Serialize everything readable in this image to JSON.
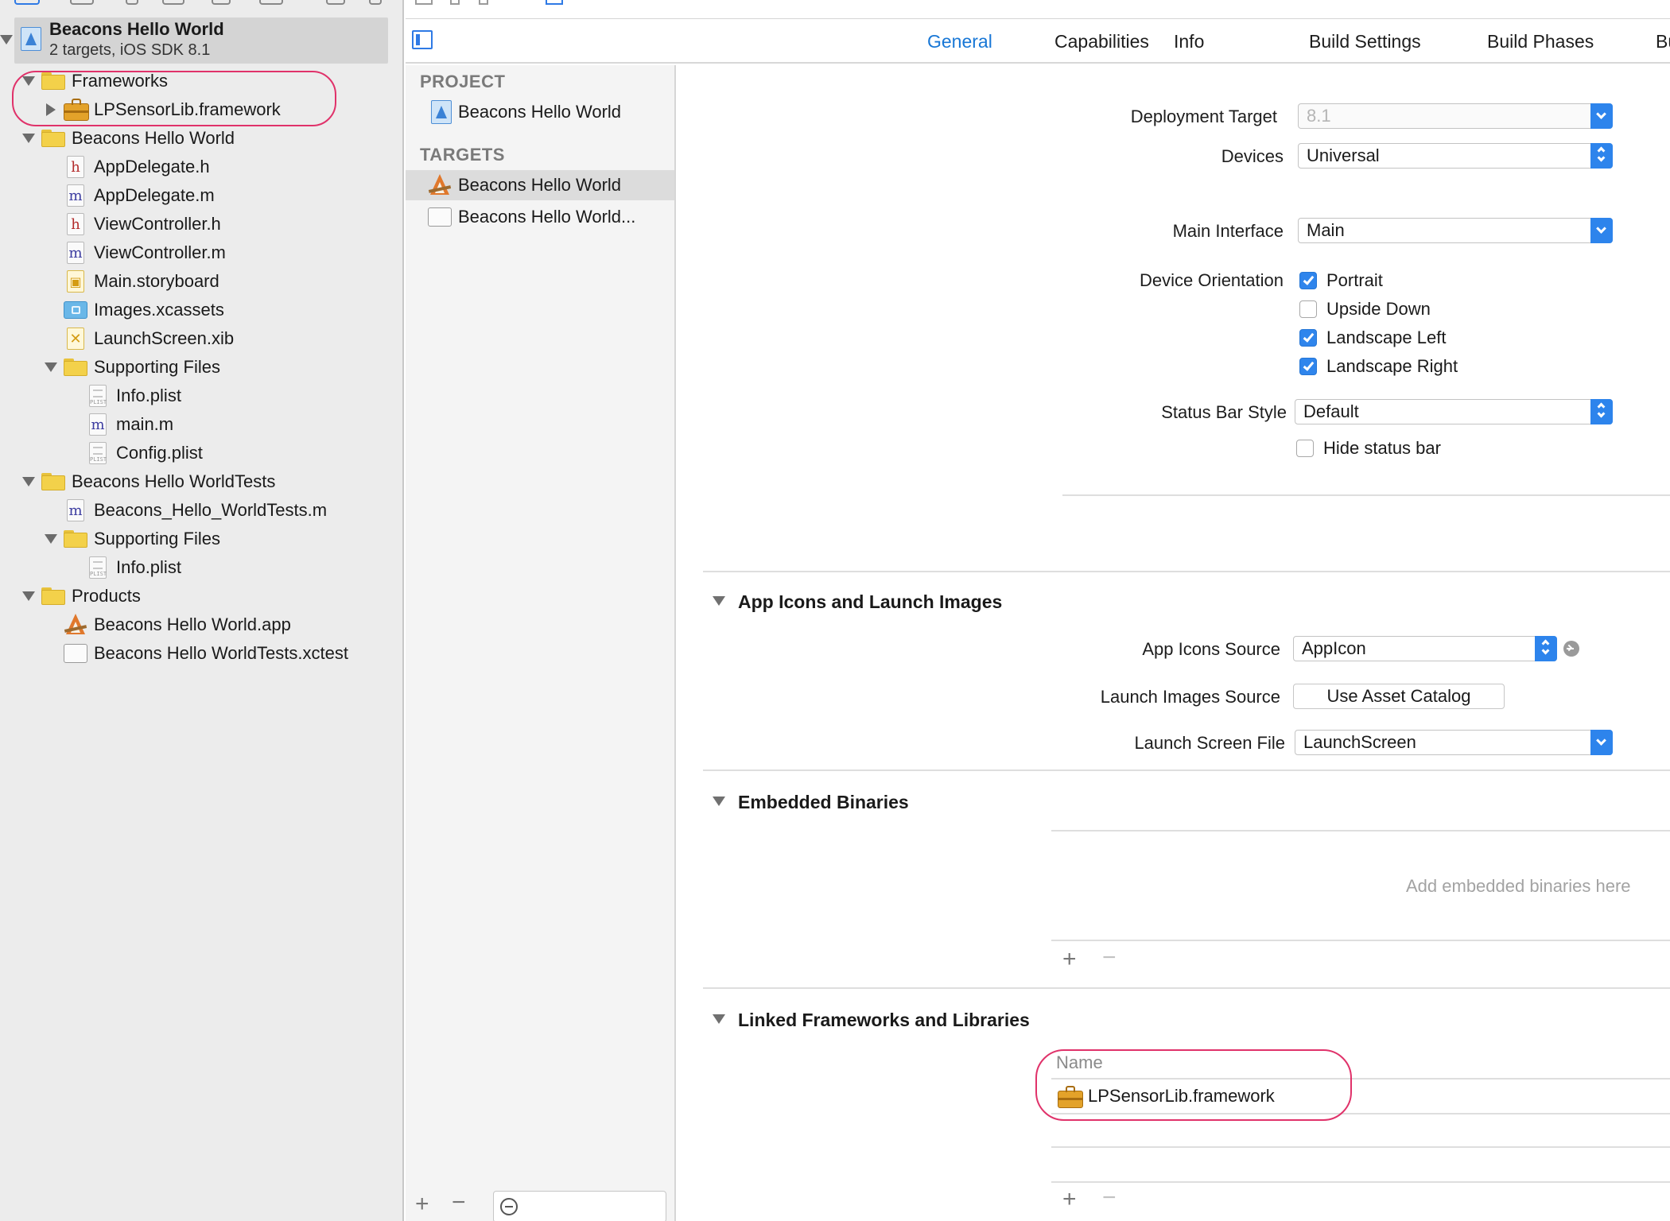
{
  "navigator": {
    "project": {
      "name": "Beacons Hello World",
      "subtitle": "2 targets, iOS SDK 8.1"
    },
    "tree": [
      {
        "label": "Frameworks",
        "icon": "folder-icon",
        "level": 1,
        "disclosure": "open"
      },
      {
        "label": "LPSensorLib.framework",
        "icon": "framework-icon",
        "level": 2,
        "disclosure": "closed"
      },
      {
        "label": "Beacons Hello World",
        "icon": "folder-icon",
        "level": 1,
        "disclosure": "open"
      },
      {
        "label": "AppDelegate.h",
        "icon": "header-file-icon",
        "level": 2
      },
      {
        "label": "AppDelegate.m",
        "icon": "source-file-icon",
        "level": 2
      },
      {
        "label": "ViewController.h",
        "icon": "header-file-icon",
        "level": 2
      },
      {
        "label": "ViewController.m",
        "icon": "source-file-icon",
        "level": 2
      },
      {
        "label": "Main.storyboard",
        "icon": "storyboard-icon",
        "level": 2
      },
      {
        "label": "Images.xcassets",
        "icon": "asset-catalog-icon",
        "level": 2
      },
      {
        "label": "LaunchScreen.xib",
        "icon": "xib-file-icon",
        "level": 2
      },
      {
        "label": "Supporting Files",
        "icon": "folder-icon",
        "level": 2,
        "disclosure": "open"
      },
      {
        "label": "Info.plist",
        "icon": "plist-file-icon",
        "level": 3
      },
      {
        "label": "main.m",
        "icon": "source-file-icon",
        "level": 3
      },
      {
        "label": "Config.plist",
        "icon": "plist-file-icon",
        "level": 3
      },
      {
        "label": "Beacons Hello WorldTests",
        "icon": "folder-icon",
        "level": 1,
        "disclosure": "open"
      },
      {
        "label": "Beacons_Hello_WorldTests.m",
        "icon": "source-file-icon",
        "level": 2
      },
      {
        "label": "Supporting Files",
        "icon": "folder-icon",
        "level": 2,
        "disclosure": "open"
      },
      {
        "label": "Info.plist",
        "icon": "plist-file-icon",
        "level": 3
      },
      {
        "label": "Products",
        "icon": "folder-icon",
        "level": 1,
        "disclosure": "open"
      },
      {
        "label": "Beacons Hello World.app",
        "icon": "app-icon",
        "level": 2
      },
      {
        "label": "Beacons Hello WorldTests.xctest",
        "icon": "test-bundle-icon",
        "level": 2
      }
    ]
  },
  "tabs": [
    {
      "label": "General",
      "active": true
    },
    {
      "label": "Capabilities"
    },
    {
      "label": "Info"
    },
    {
      "label": "Build Settings"
    },
    {
      "label": "Build Phases"
    },
    {
      "label": "Bu"
    }
  ],
  "targets_pane": {
    "project_header": "PROJECT",
    "project_item": "Beacons Hello World",
    "targets_header": "TARGETS",
    "target_items": [
      "Beacons Hello World",
      "Beacons Hello World..."
    ]
  },
  "general": {
    "deployment_target": {
      "label": "Deployment Target",
      "value": "8.1"
    },
    "devices": {
      "label": "Devices",
      "value": "Universal"
    },
    "main_interface": {
      "label": "Main Interface",
      "value": "Main"
    },
    "device_orientation": {
      "label": "Device Orientation",
      "options": [
        {
          "label": "Portrait",
          "checked": true
        },
        {
          "label": "Upside Down",
          "checked": false
        },
        {
          "label": "Landscape Left",
          "checked": true
        },
        {
          "label": "Landscape Right",
          "checked": true
        }
      ]
    },
    "status_bar_style": {
      "label": "Status Bar Style",
      "value": "Default"
    },
    "hide_status_bar": {
      "label": "Hide status bar",
      "checked": false
    },
    "app_icons_section": {
      "title": "App Icons and Launch Images",
      "app_icons_source": {
        "label": "App Icons Source",
        "value": "AppIcon"
      },
      "launch_images_source": {
        "label": "Launch Images Source",
        "button": "Use Asset Catalog"
      },
      "launch_screen_file": {
        "label": "Launch Screen File",
        "value": "LaunchScreen"
      }
    },
    "embedded_binaries": {
      "title": "Embedded Binaries",
      "placeholder": "Add embedded binaries here"
    },
    "linked_frameworks": {
      "title": "Linked Frameworks and Libraries",
      "column_header": "Name",
      "items": [
        "LPSensorLib.framework"
      ]
    }
  },
  "colors": {
    "accent": "#2f7ae5",
    "annotation": "#e0326a",
    "folder": "#f3d14a"
  }
}
